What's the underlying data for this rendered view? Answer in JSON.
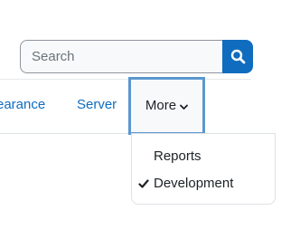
{
  "search": {
    "placeholder": "Search",
    "value": "",
    "button_icon": "magnifier-icon"
  },
  "nav": {
    "items": [
      {
        "label": "earance",
        "selected": false
      },
      {
        "label": "Server",
        "selected": false
      },
      {
        "label": "More",
        "selected": true,
        "icon": "chevron-down-icon"
      }
    ]
  },
  "more_menu": {
    "items": [
      {
        "label": "Reports",
        "checked": false
      },
      {
        "label": "Development",
        "checked": true,
        "icon": "checkmark-icon"
      }
    ]
  },
  "colors": {
    "primary": "#0f6cbf",
    "focus_outline": "#5b97cf",
    "text": "#1d2125",
    "input_background": "#f8f9fa",
    "border": "#dee2e6"
  }
}
